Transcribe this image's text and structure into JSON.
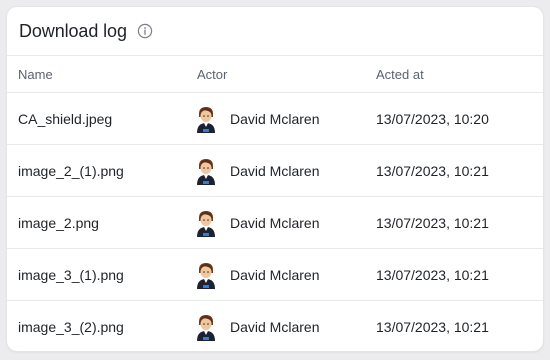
{
  "panel": {
    "title": "Download log"
  },
  "table": {
    "headers": {
      "name": "Name",
      "actor": "Actor",
      "acted_at": "Acted at"
    },
    "rows": [
      {
        "name": "CA_shield.jpeg",
        "actor": "David Mclaren",
        "acted_at": "13/07/2023, 10:20"
      },
      {
        "name": "image_2_(1).png",
        "actor": "David Mclaren",
        "acted_at": "13/07/2023, 10:21"
      },
      {
        "name": "image_2.png",
        "actor": "David Mclaren",
        "acted_at": "13/07/2023, 10:21"
      },
      {
        "name": "image_3_(1).png",
        "actor": "David Mclaren",
        "acted_at": "13/07/2023, 10:21"
      },
      {
        "name": "image_3_(2).png",
        "actor": "David Mclaren",
        "acted_at": "13/07/2023, 10:21"
      }
    ]
  },
  "icons": {
    "info": "info-circle-icon",
    "avatar": "user-avatar"
  },
  "colors": {
    "background": "#ececee",
    "card": "#ffffff",
    "border": "#e8e9ec",
    "text": "#1f2328",
    "muted": "#5b6270"
  }
}
